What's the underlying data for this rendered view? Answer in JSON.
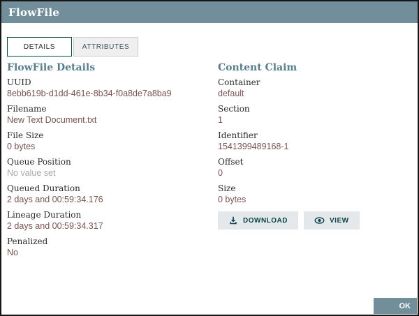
{
  "dialog": {
    "title": "FlowFile"
  },
  "tabs": [
    {
      "label": "DETAILS",
      "active": true
    },
    {
      "label": "ATTRIBUTES",
      "active": false
    }
  ],
  "left_section": {
    "heading": "FlowFile Details",
    "fields": [
      {
        "label": "UUID",
        "value": "8ebb619b-d1dd-461e-8b34-f0a8de7a8ba9",
        "unset": false
      },
      {
        "label": "Filename",
        "value": "New Text Document.txt",
        "unset": false
      },
      {
        "label": "File Size",
        "value": "0 bytes",
        "unset": false
      },
      {
        "label": "Queue Position",
        "value": "No value set",
        "unset": true
      },
      {
        "label": "Queued Duration",
        "value": "2 days and 00:59:34.176",
        "unset": false
      },
      {
        "label": "Lineage Duration",
        "value": "2 days and 00:59:34.317",
        "unset": false
      },
      {
        "label": "Penalized",
        "value": "No",
        "unset": false
      }
    ]
  },
  "right_section": {
    "heading": "Content Claim",
    "fields": [
      {
        "label": "Container",
        "value": "default",
        "unset": false
      },
      {
        "label": "Section",
        "value": "1",
        "unset": false
      },
      {
        "label": "Identifier",
        "value": "1541399489168-1",
        "unset": false
      },
      {
        "label": "Offset",
        "value": "0",
        "unset": false
      },
      {
        "label": "Size",
        "value": "0 bytes",
        "unset": false
      }
    ],
    "buttons": [
      {
        "label": "DOWNLOAD",
        "icon": "download-icon"
      },
      {
        "label": "VIEW",
        "icon": "eye-icon"
      }
    ]
  },
  "footer": {
    "ok_label": "OK"
  },
  "colors": {
    "header_bg": "#728e9b",
    "section_heading": "#587e8c",
    "value_text": "#775351",
    "unset_text": "#a8a8a8",
    "tab_active_border": "#004849",
    "action_button_bg": "#e4e8eb",
    "action_button_text": "#0b434b",
    "ok_button_bg": "#728e9b"
  }
}
